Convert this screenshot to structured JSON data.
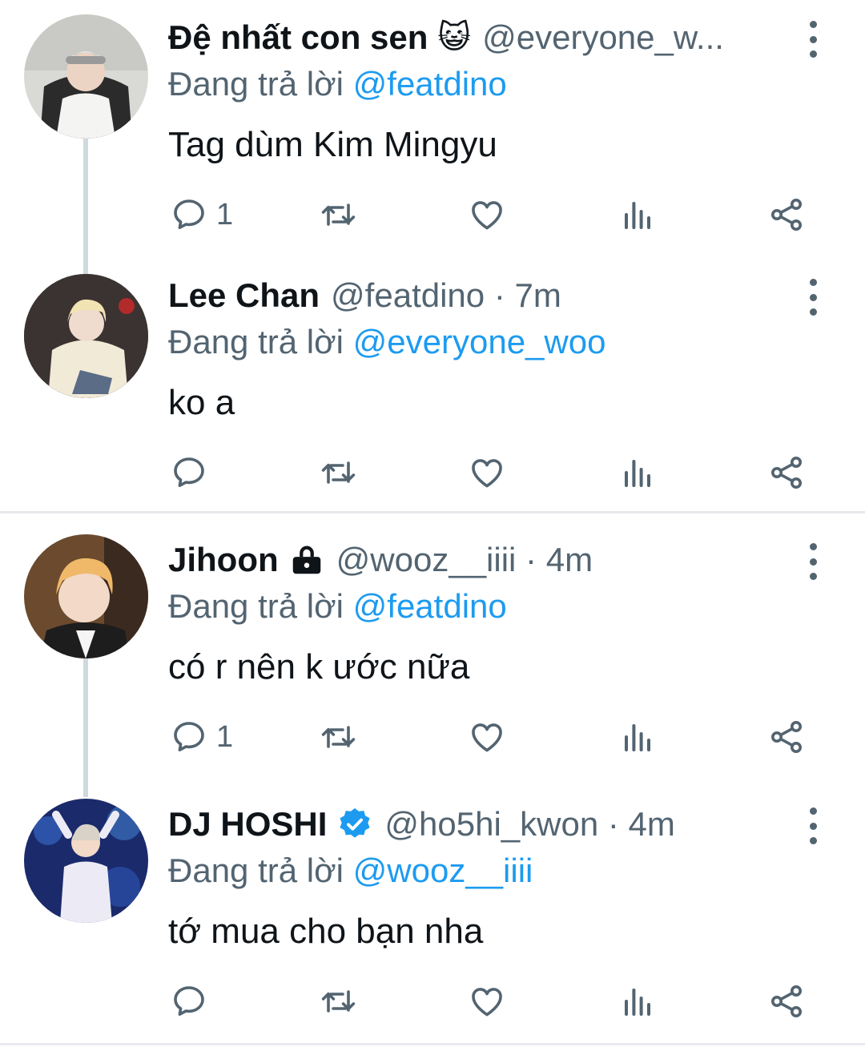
{
  "reply_prefix": "Đang trả lời",
  "tweets": [
    {
      "name": "Đệ nhất con sen",
      "emoji": "😺",
      "handle": "@everyone_w...",
      "replying_to": "@featdino",
      "text": "Tag dùm Kim Mingyu",
      "reply_count": "1"
    },
    {
      "name": "Lee Chan",
      "handle": "@featdino · 7m",
      "replying_to": "@everyone_woo",
      "text": "ko a",
      "reply_count": ""
    },
    {
      "name": "Jihoon",
      "handle": "@wooz__iiii · 4m",
      "replying_to": "@featdino",
      "text": "có r nên k ước nữa",
      "reply_count": "1"
    },
    {
      "name": "DJ HOSHI",
      "handle": "@ho5hi_kwon · 4m",
      "replying_to": "@wooz__iiii",
      "text": "tớ mua cho bạn nha",
      "reply_count": ""
    }
  ],
  "colors": {
    "accent": "#1d9bf0",
    "secondary_text": "#536471",
    "icon": "#536471",
    "thread_line": "#cfd9de",
    "verified": "#1d9bf0"
  },
  "icons": {
    "reply": "reply-icon",
    "retweet": "retweet-icon",
    "like": "heart-icon",
    "views": "analytics-icon",
    "share": "share-icon",
    "more": "more-vertical-icon",
    "lock": "lock-icon",
    "verified": "verified-badge-icon"
  }
}
